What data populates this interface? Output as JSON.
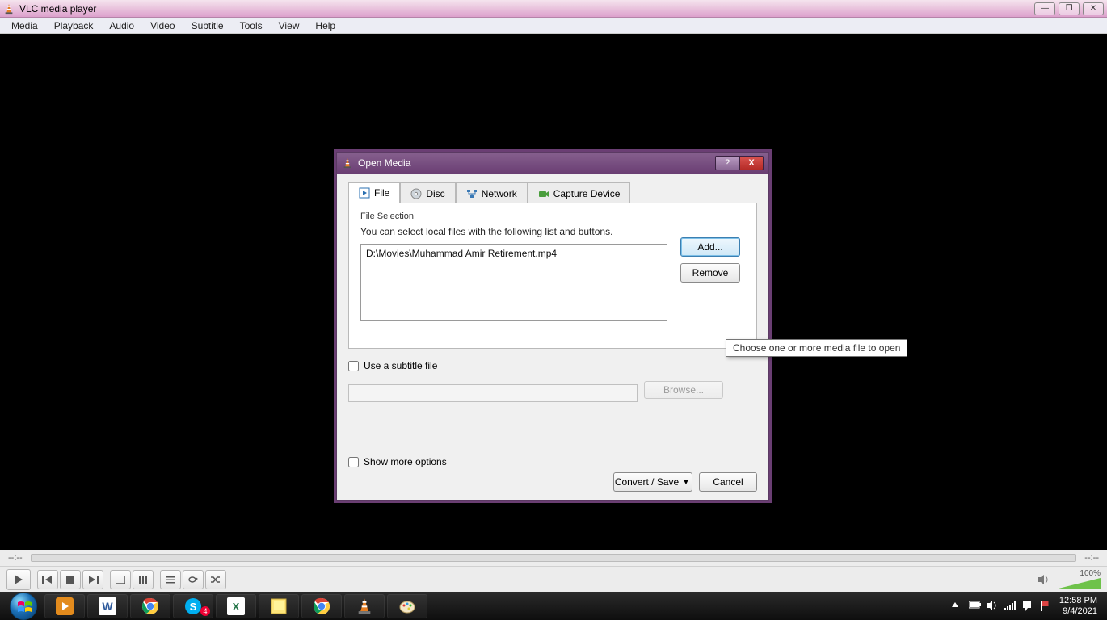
{
  "window": {
    "title": "VLC media player",
    "caption_min": "—",
    "caption_max": "❐",
    "caption_close": "✕"
  },
  "menubar": {
    "items": [
      "Media",
      "Playback",
      "Audio",
      "Video",
      "Subtitle",
      "Tools",
      "View",
      "Help"
    ]
  },
  "dialog": {
    "title": "Open Media",
    "help": "?",
    "close": "X",
    "tabs": {
      "file": "File",
      "disc": "Disc",
      "network": "Network",
      "capture": "Capture Device"
    },
    "file_section": {
      "header": "File Selection",
      "hint": "You can select local files with the following list and buttons.",
      "list_item": "D:\\Movies\\Muhammad Amir Retirement.mp4",
      "add": "Add...",
      "remove": "Remove"
    },
    "subtitle": {
      "label": "Use a subtitle file",
      "browse": "Browse..."
    },
    "more_options": "Show more options",
    "convert": "Convert / Save",
    "cancel": "Cancel"
  },
  "tooltip": {
    "text": "Choose one or more media file to open"
  },
  "seek": {
    "elapsed": "--:--",
    "remaining": "--:--"
  },
  "volume": {
    "pct": "100%"
  },
  "tray": {
    "time": "12:58 PM",
    "date": "9/4/2021"
  }
}
